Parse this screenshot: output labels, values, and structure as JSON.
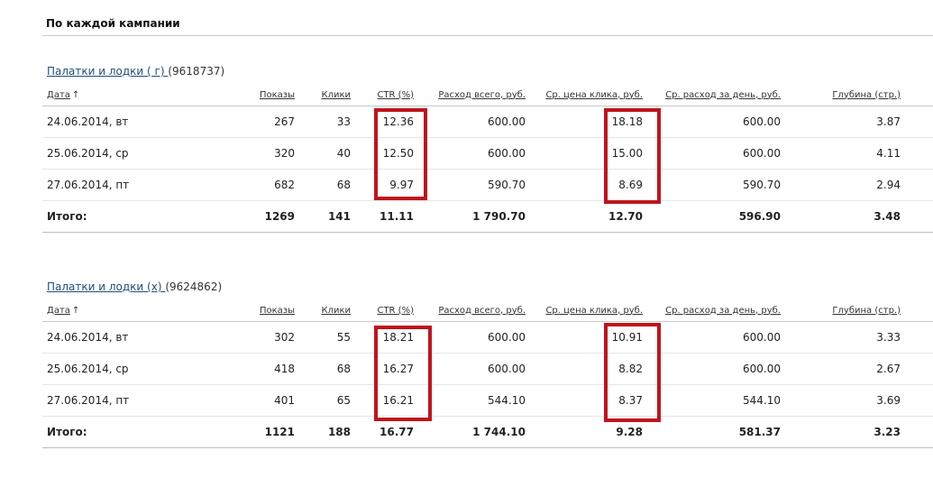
{
  "section_title": "По каждой кампании",
  "columns": {
    "date": "Дата",
    "sort_arrow": "↑",
    "shows": "Показы",
    "clicks": "Клики",
    "ctr": "CTR (%)",
    "spend": "Расход всего, руб.",
    "avg_cpc": "Ср. цена клика, руб.",
    "avg_daily": "Ср. расход за день, руб.",
    "depth": "Глубина (стр.)"
  },
  "highlight_color": "#c0141c",
  "campaigns": [
    {
      "name": "Палатки и лодки ( г) ",
      "id": "(9618737)",
      "rows": [
        {
          "date": "24.06.2014, вт",
          "shows": "267",
          "clicks": "33",
          "ctr": "12.36",
          "spend": "600.00",
          "avg_cpc": "18.18",
          "avg_daily": "600.00",
          "depth": "3.87"
        },
        {
          "date": "25.06.2014, ср",
          "shows": "320",
          "clicks": "40",
          "ctr": "12.50",
          "spend": "600.00",
          "avg_cpc": "15.00",
          "avg_daily": "600.00",
          "depth": "4.11"
        },
        {
          "date": "27.06.2014, пт",
          "shows": "682",
          "clicks": "68",
          "ctr": "9.97",
          "spend": "590.70",
          "avg_cpc": "8.69",
          "avg_daily": "590.70",
          "depth": "2.94"
        }
      ],
      "total": {
        "label": "Итого:",
        "shows": "1269",
        "clicks": "141",
        "ctr": "11.11",
        "spend": "1 790.70",
        "avg_cpc": "12.70",
        "avg_daily": "596.90",
        "depth": "3.48"
      }
    },
    {
      "name": "Палатки и лодки (х) ",
      "id": "(9624862)",
      "rows": [
        {
          "date": "24.06.2014, вт",
          "shows": "302",
          "clicks": "55",
          "ctr": "18.21",
          "spend": "600.00",
          "avg_cpc": "10.91",
          "avg_daily": "600.00",
          "depth": "3.33"
        },
        {
          "date": "25.06.2014, ср",
          "shows": "418",
          "clicks": "68",
          "ctr": "16.27",
          "spend": "600.00",
          "avg_cpc": "8.82",
          "avg_daily": "600.00",
          "depth": "2.67"
        },
        {
          "date": "27.06.2014, пт",
          "shows": "401",
          "clicks": "65",
          "ctr": "16.21",
          "spend": "544.10",
          "avg_cpc": "8.37",
          "avg_daily": "544.10",
          "depth": "3.69"
        }
      ],
      "total": {
        "label": "Итого:",
        "shows": "1121",
        "clicks": "188",
        "ctr": "16.77",
        "spend": "1 744.10",
        "avg_cpc": "9.28",
        "avg_daily": "581.37",
        "depth": "3.23"
      }
    }
  ]
}
